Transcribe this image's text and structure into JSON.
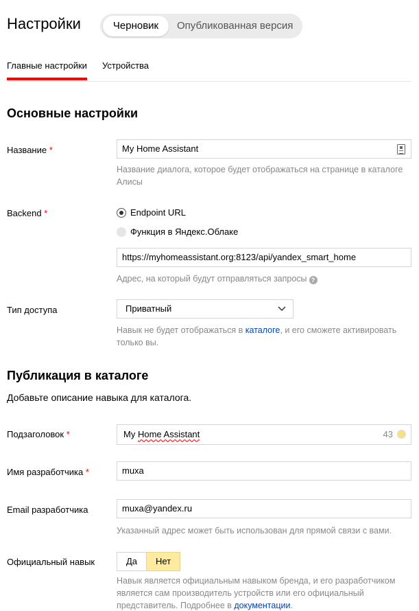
{
  "header": {
    "title": "Настройки",
    "versions": {
      "draft": "Черновик",
      "published": "Опубликованная версия"
    }
  },
  "tabs": [
    {
      "label": "Главные настройки",
      "active": true
    },
    {
      "label": "Устройства",
      "active": false
    }
  ],
  "main": {
    "section_title": "Основные настройки",
    "name": {
      "label": "Название",
      "required": "*",
      "value": "My Home Assistant",
      "hint": "Название диалога, которое будет отображаться на странице в каталоге Алисы"
    },
    "backend": {
      "label": "Backend",
      "required": "*",
      "options": [
        {
          "label": "Endpoint URL",
          "selected": true
        },
        {
          "label": "Функция в Яндекс.Облаке",
          "selected": false
        }
      ],
      "url": "https://myhomeassistant.org:8123/api/yandex_smart_home",
      "hint": "Адрес, на который будут отправляться запросы",
      "help_icon": "?"
    },
    "access": {
      "label": "Тип доступа",
      "value": "Приватный",
      "hint_before": "Навык не будет отображаться в ",
      "hint_link": "каталоге",
      "hint_after": ", и его сможете активировать только вы."
    }
  },
  "catalog": {
    "section_title": "Публикация в каталоге",
    "description": "Добавьте описание навыка для каталога.",
    "subtitle": {
      "label": "Подзаголовок",
      "required": "*",
      "value_plain": "My ",
      "value_spell": "Home Assistant",
      "counter": "43"
    },
    "developer": {
      "label": "Имя разработчика",
      "required": "*",
      "value": "muxa"
    },
    "email": {
      "label": "Email разработчика",
      "value": "muxa@yandex.ru",
      "hint": "Указанный адрес может быть использован для прямой связи с вами."
    },
    "official": {
      "label": "Официальный навык",
      "yes": "Да",
      "no": "Нет",
      "selected": "Нет",
      "hint_before": "Навык является официальным навыком бренда, и его разработчиком является сам производитель устройств или его официальный представитель. Подробнее в ",
      "hint_link": "документации",
      "hint_after": "."
    }
  },
  "colors": {
    "accent": "#ff0000",
    "link": "#0044bb",
    "toggle_selected": "#ffeba0"
  }
}
